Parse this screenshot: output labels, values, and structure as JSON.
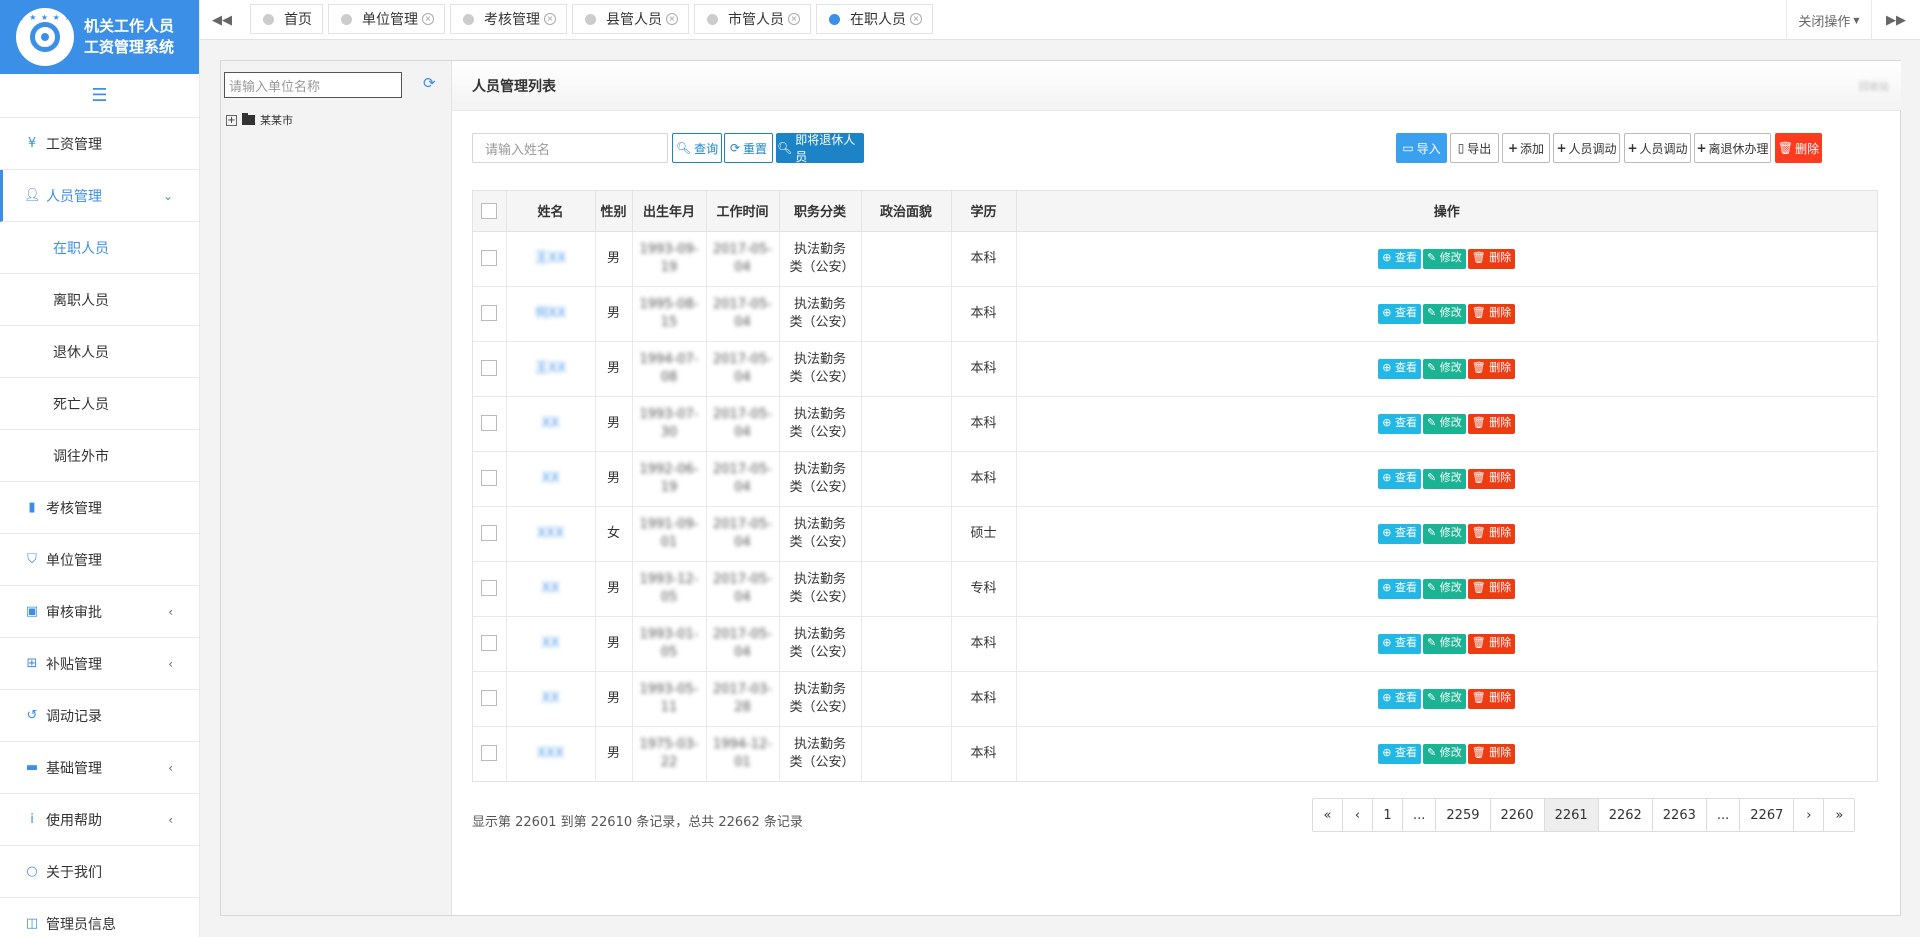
{
  "app": {
    "title_line1": "机关工作人员",
    "title_line2": "工资管理系统",
    "logo_stars": "★ ★ ★ ★ ★"
  },
  "sidebar": {
    "items": [
      {
        "label": "工资管理",
        "icon": "yen-icon"
      },
      {
        "label": "人员管理",
        "icon": "user-plus-icon",
        "active": true
      },
      {
        "label": "在职人员",
        "sub": true,
        "active": true
      },
      {
        "label": "离职人员",
        "sub": true
      },
      {
        "label": "退休人员",
        "sub": true
      },
      {
        "label": "死亡人员",
        "sub": true
      },
      {
        "label": "调往外市",
        "sub": true
      },
      {
        "label": "考核管理",
        "icon": "book-icon"
      },
      {
        "label": "单位管理",
        "icon": "shield-icon"
      },
      {
        "label": "审核审批",
        "icon": "calendar-check-icon",
        "arrow": true
      },
      {
        "label": "补贴管理",
        "icon": "plus-square-icon",
        "arrow": true
      },
      {
        "label": "调动记录",
        "icon": "history-icon"
      },
      {
        "label": "基础管理",
        "icon": "archive-icon",
        "arrow": true
      },
      {
        "label": "使用帮助",
        "icon": "info-icon",
        "arrow": true
      },
      {
        "label": "关于我们",
        "icon": "circle-icon"
      },
      {
        "label": "管理员信息",
        "icon": "columns-icon"
      }
    ]
  },
  "topbar": {
    "tabs": [
      {
        "label": "首页",
        "closable": false
      },
      {
        "label": "单位管理",
        "closable": true
      },
      {
        "label": "考核管理",
        "closable": true
      },
      {
        "label": "县管人员",
        "closable": true
      },
      {
        "label": "市管人员",
        "closable": true
      },
      {
        "label": "在职人员",
        "closable": true,
        "active": true
      }
    ],
    "close_ops_label": "关闭操作"
  },
  "tree": {
    "search_placeholder": "请输入单位名称",
    "root_label": "某某市"
  },
  "panel": {
    "title": "人员管理列表",
    "head_right": "回收站",
    "search_placeholder": "请输入姓名",
    "buttons": {
      "query": "查询",
      "reset": "重置",
      "retiring": "即将退休人员",
      "import": "导入",
      "export": "导出",
      "add": "添加",
      "transfer1": "人员调动",
      "transfer2": "人员调动",
      "retire": "离退休办理",
      "delete": "删除"
    }
  },
  "table": {
    "headers": [
      "",
      "姓名",
      "性别",
      "出生年月",
      "工作时间",
      "职务分类",
      "政治面貌",
      "学历",
      "操作"
    ],
    "actions": {
      "view": "查看",
      "edit": "修改",
      "delete": "删除"
    },
    "rows": [
      {
        "name": "王XX",
        "gender": "男",
        "birth": "1993-09-19",
        "work": "2017-05-04",
        "category": "执法勤务类（公安）",
        "political": "",
        "edu": "本科"
      },
      {
        "name": "何XX",
        "gender": "男",
        "birth": "1995-08-15",
        "work": "2017-05-04",
        "category": "执法勤务类（公安）",
        "political": "",
        "edu": "本科"
      },
      {
        "name": "王XX",
        "gender": "男",
        "birth": "1994-07-08",
        "work": "2017-05-04",
        "category": "执法勤务类（公安）",
        "political": "",
        "edu": "本科"
      },
      {
        "name": "XX",
        "gender": "男",
        "birth": "1993-07-30",
        "work": "2017-05-04",
        "category": "执法勤务类（公安）",
        "political": "",
        "edu": "本科"
      },
      {
        "name": "XX",
        "gender": "男",
        "birth": "1992-06-19",
        "work": "2017-05-04",
        "category": "执法勤务类（公安）",
        "political": "",
        "edu": "本科"
      },
      {
        "name": "XXX",
        "gender": "女",
        "birth": "1991-09-01",
        "work": "2017-05-04",
        "category": "执法勤务类（公安）",
        "political": "",
        "edu": "硕士"
      },
      {
        "name": "XX",
        "gender": "男",
        "birth": "1993-12-05",
        "work": "2017-05-04",
        "category": "执法勤务类（公安）",
        "political": "",
        "edu": "专科"
      },
      {
        "name": "XX",
        "gender": "男",
        "birth": "1993-01-05",
        "work": "2017-05-04",
        "category": "执法勤务类（公安）",
        "political": "",
        "edu": "本科"
      },
      {
        "name": "XX",
        "gender": "男",
        "birth": "1993-05-11",
        "work": "2017-03-28",
        "category": "执法勤务类（公安）",
        "political": "",
        "edu": "本科"
      },
      {
        "name": "XXX",
        "gender": "男",
        "birth": "1975-03-22",
        "work": "1994-12-01",
        "category": "执法勤务类（公安）",
        "political": "",
        "edu": "本科"
      }
    ]
  },
  "footer": {
    "info": "显示第 22601 到第 22610 条记录，总共 22662 条记录",
    "pages": [
      "«",
      "‹",
      "1",
      "...",
      "2259",
      "2260",
      "2261",
      "2262",
      "2263",
      "...",
      "2267",
      "›",
      "»"
    ],
    "current_page": "2261"
  },
  "colors": {
    "accent": "#3c8fe6",
    "danger": "#ed3b12",
    "success": "#1ab394",
    "info": "#23b7e5"
  }
}
